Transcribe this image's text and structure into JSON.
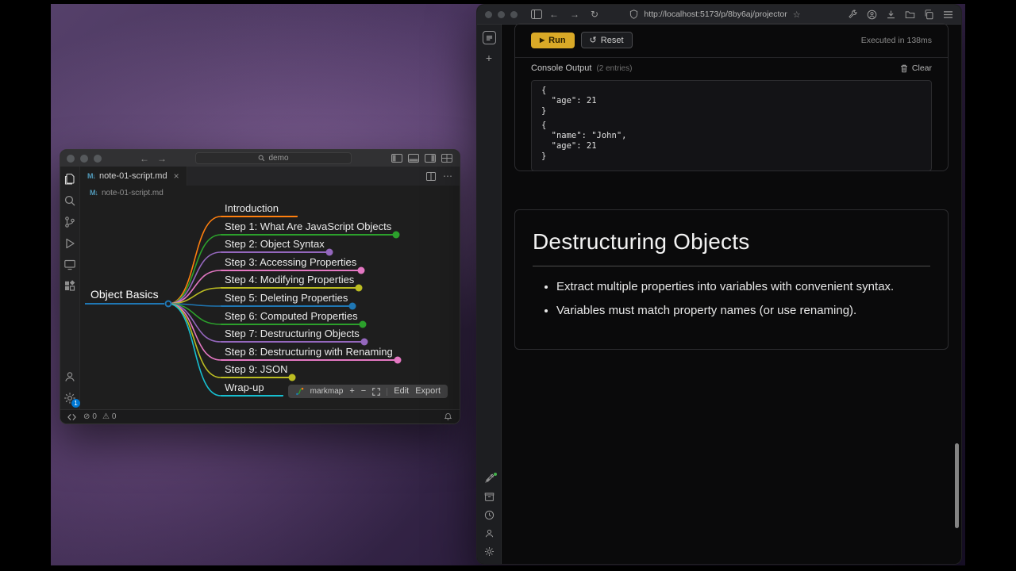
{
  "vscode": {
    "search_placeholder": "demo",
    "tab_label": "note-01-script.md",
    "breadcrumb": "note-01-script.md",
    "mindmap": {
      "root": {
        "label": "Object Basics",
        "color": "#1f77b4"
      },
      "nodes": [
        {
          "label": "Introduction",
          "color": "#ff7f0e",
          "dot": false
        },
        {
          "label": "Step 1: What Are JavaScript Objects",
          "color": "#2ca02c",
          "dot": true
        },
        {
          "label": "Step 2: Object Syntax",
          "color": "#9467bd",
          "dot": true
        },
        {
          "label": "Step 3: Accessing Properties",
          "color": "#e377c2",
          "dot": true
        },
        {
          "label": "Step 4: Modifying Properties",
          "color": "#bcbd22",
          "dot": true
        },
        {
          "label": "Step 5: Deleting Properties",
          "color": "#1f77b4",
          "dot": true
        },
        {
          "label": "Step 6: Computed Properties",
          "color": "#2ca02c",
          "dot": true
        },
        {
          "label": "Step 7: Destructuring Objects",
          "color": "#9467bd",
          "dot": true
        },
        {
          "label": "Step 8: Destructuring with Renaming",
          "color": "#e377c2",
          "dot": true
        },
        {
          "label": "Step 9: JSON",
          "color": "#bcbd22",
          "dot": true
        },
        {
          "label": "Wrap-up",
          "color": "#17becf",
          "dot": false
        }
      ]
    },
    "markmap_toolbar": {
      "brand": "markmap",
      "zoom_in": "+",
      "zoom_out": "−",
      "edit": "Edit",
      "export": "Export"
    },
    "status": {
      "errors": "0",
      "warnings": "0"
    },
    "settings_badge": "1"
  },
  "browser": {
    "url": "http://localhost:5173/p/8by6aj/projector",
    "page": {
      "run_label": "Run",
      "reset_label": "Reset",
      "executed_note": "Executed in 138ms",
      "console": {
        "title": "Console Output",
        "entries_note": "(2 entries)",
        "clear_label": "Clear",
        "entries": [
          {
            "lines": [
              "{",
              "  \"age\": 21",
              "}"
            ]
          },
          {
            "lines": [
              "{",
              "  \"name\": \"John\",",
              "  \"age\": 21",
              "}"
            ]
          }
        ]
      },
      "section": {
        "title": "Destructuring Objects",
        "bullets": [
          "Extract multiple properties into variables with convenient syntax.",
          "Variables must match property names (or use renaming)."
        ]
      }
    }
  }
}
